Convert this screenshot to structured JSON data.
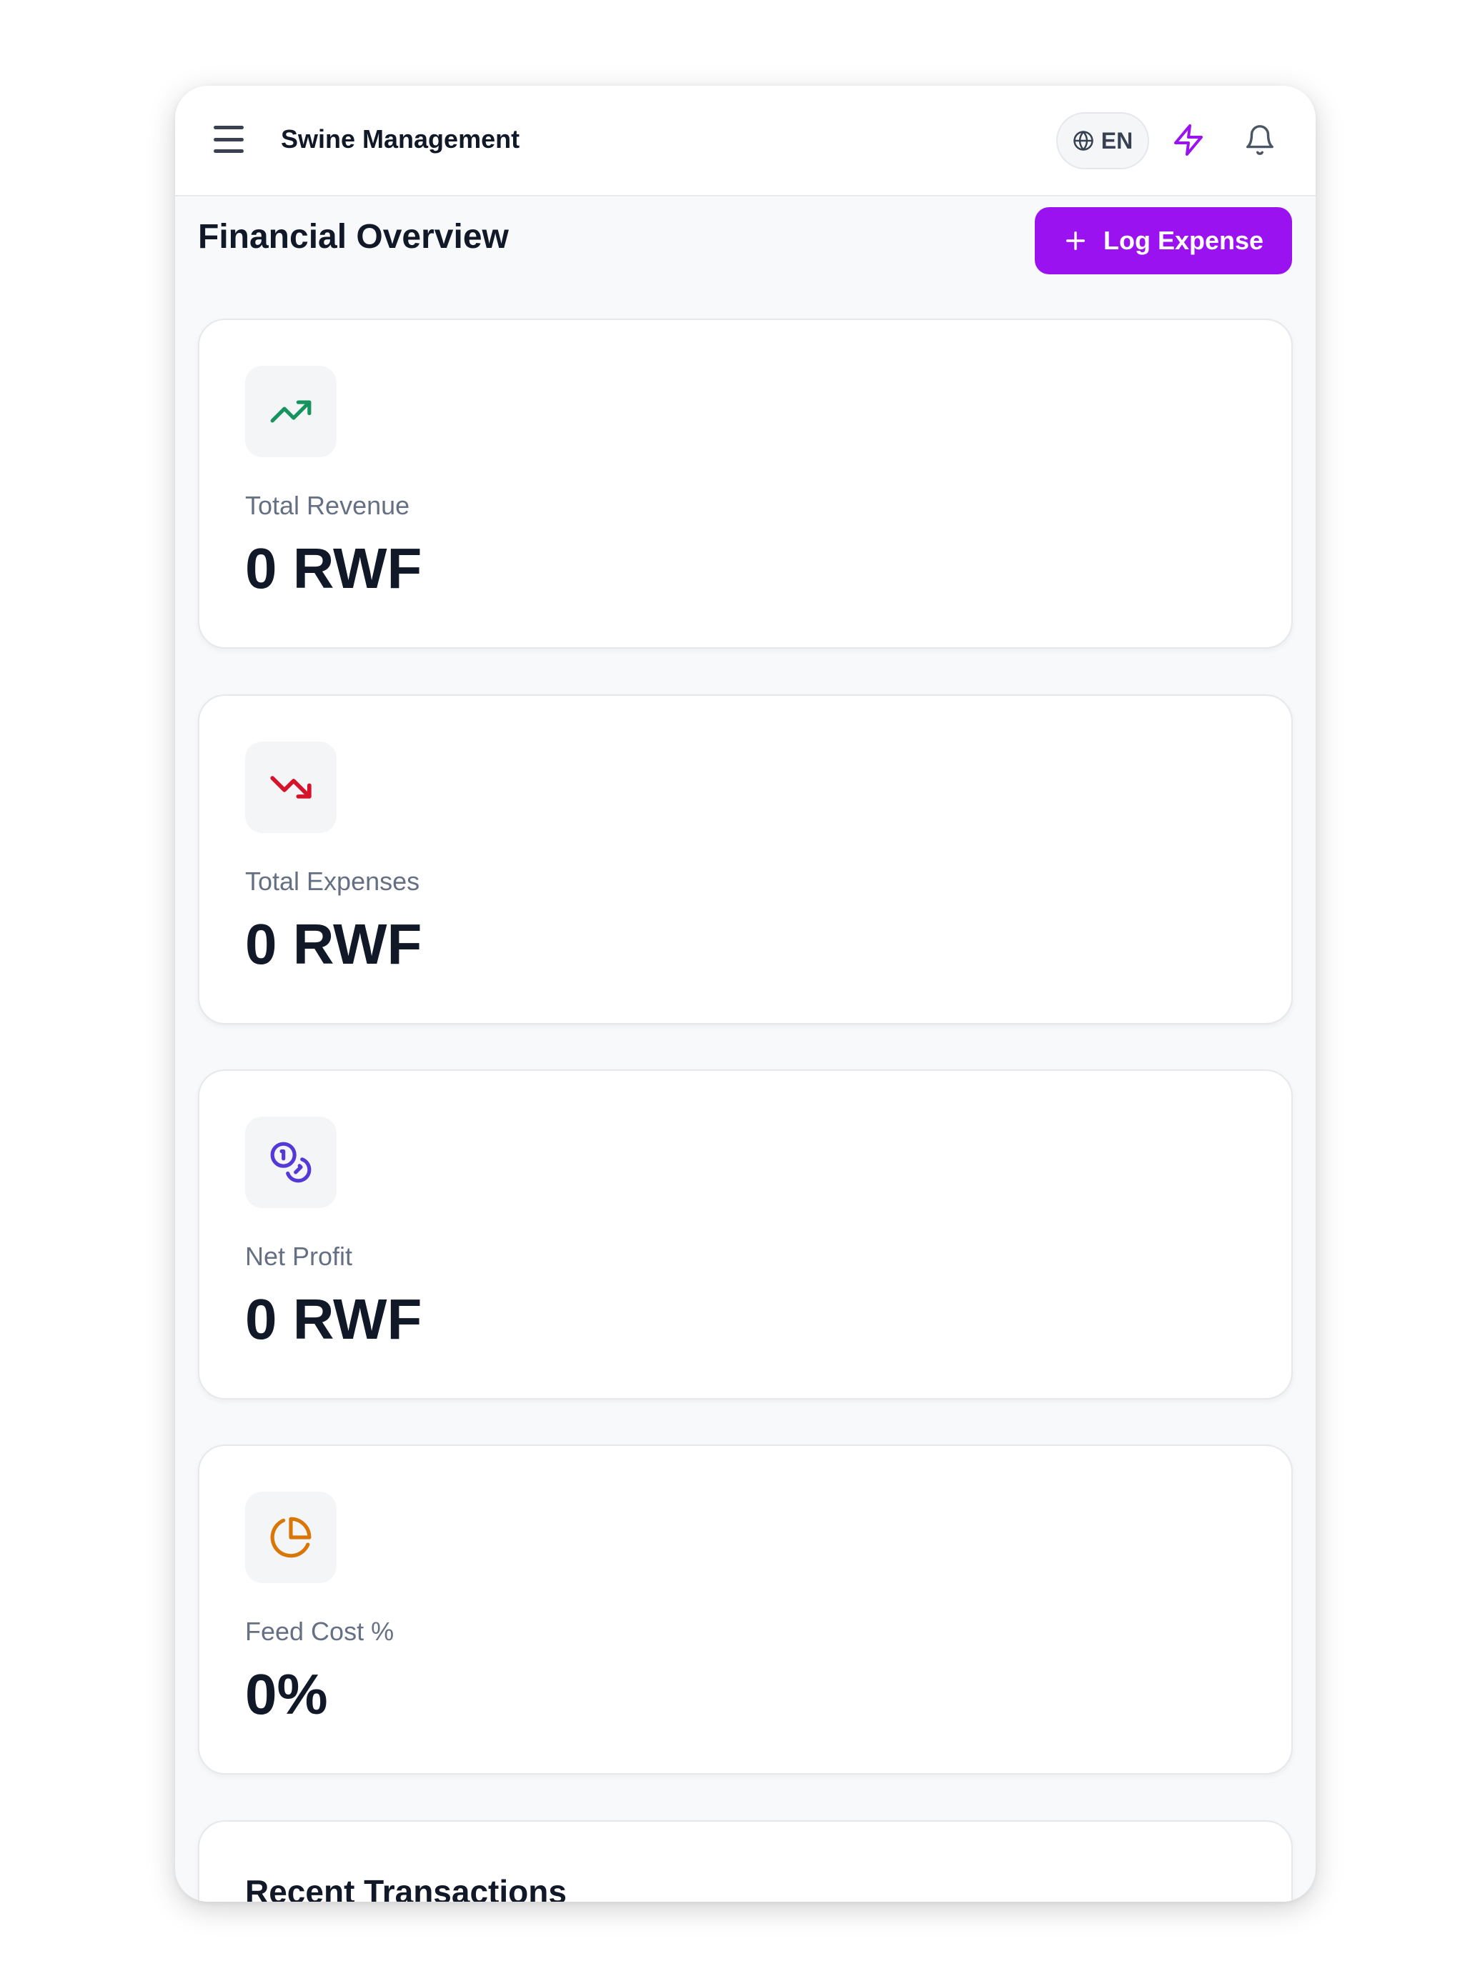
{
  "app": {
    "title": "Swine Management"
  },
  "header": {
    "language_label": "EN"
  },
  "page": {
    "title": "Financial Overview",
    "log_expense_label": "Log Expense"
  },
  "stats": [
    {
      "label": "Total Revenue",
      "value": "0 RWF",
      "icon": "trending-up-icon",
      "color": "#16935f"
    },
    {
      "label": "Total Expenses",
      "value": "0 RWF",
      "icon": "trending-down-icon",
      "color": "#d5142b"
    },
    {
      "label": "Net Profit",
      "value": "0 RWF",
      "icon": "coins-icon",
      "color": "#5538d8"
    },
    {
      "label": "Feed Cost %",
      "value": "0%",
      "icon": "pie-chart-icon",
      "color": "#d97706"
    }
  ],
  "transactions": {
    "title": "Recent Transactions"
  },
  "colors": {
    "accent": "#9b12f0",
    "page_background": "#f8f9fb"
  }
}
